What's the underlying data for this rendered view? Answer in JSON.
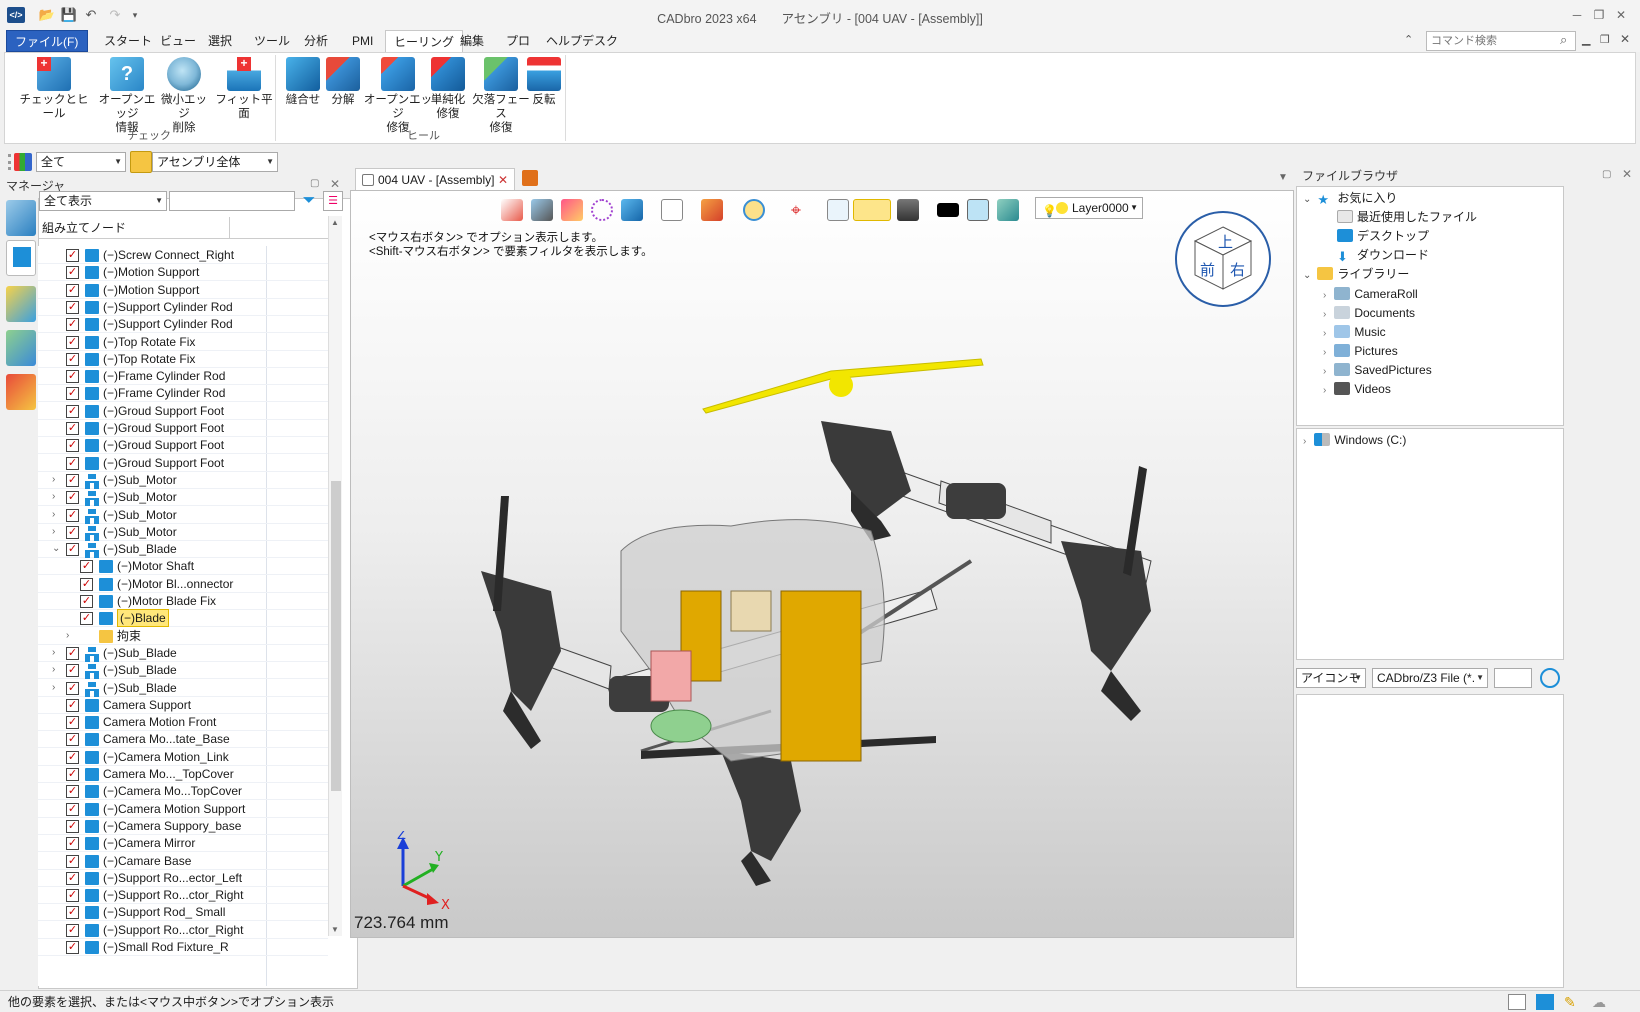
{
  "window": {
    "title": "CADbro 2023 x64　　アセンブリ - [004 UAV - [Assembly]]",
    "app_icon": "cadbro-logo-icon"
  },
  "menu": {
    "tabs": [
      "ファイル(F)",
      "スタート",
      "ビュー",
      "選択",
      "ツール",
      "分析",
      "PMI",
      "ヒーリング",
      "編集",
      "プロ",
      "ヘルプデスク"
    ],
    "active": "ヒーリング",
    "search_placeholder": "コマンド検索"
  },
  "ribbon": {
    "groups": [
      {
        "label": "チェック",
        "buttons": [
          "チェックとヒール",
          "オープンエッジ\n情報",
          "微小エッジ\n削除",
          "フィット平面"
        ]
      },
      {
        "label": "ヒール",
        "buttons": [
          "縫合せ",
          "分解",
          "オープンエッジ\n修復",
          "単純化\n修復",
          "欠落フェース\n修復",
          "反転"
        ]
      }
    ]
  },
  "filterbar": {
    "filter_value": "全て",
    "scope_value": "アセンブリ全体"
  },
  "manager": {
    "title": "マネージャ",
    "display_mode": "全て表示",
    "column_header": "組み立てノード",
    "rows": [
      {
        "label": "(−)Screw Connect_Right",
        "indent": 0,
        "type": "part",
        "exp": ""
      },
      {
        "label": "(−)Motion Support",
        "indent": 0,
        "type": "part",
        "exp": ""
      },
      {
        "label": "(−)Motion Support",
        "indent": 0,
        "type": "part",
        "exp": ""
      },
      {
        "label": "(−)Support Cylinder Rod",
        "indent": 0,
        "type": "part",
        "exp": ""
      },
      {
        "label": "(−)Support Cylinder Rod",
        "indent": 0,
        "type": "part",
        "exp": ""
      },
      {
        "label": "(−)Top Rotate Fix",
        "indent": 0,
        "type": "part",
        "exp": ""
      },
      {
        "label": "(−)Top Rotate Fix",
        "indent": 0,
        "type": "part",
        "exp": ""
      },
      {
        "label": "(−)Frame Cylinder Rod",
        "indent": 0,
        "type": "part",
        "exp": ""
      },
      {
        "label": "(−)Frame Cylinder Rod",
        "indent": 0,
        "type": "part",
        "exp": ""
      },
      {
        "label": "(−)Groud Support Foot",
        "indent": 0,
        "type": "part",
        "exp": ""
      },
      {
        "label": "(−)Groud Support Foot",
        "indent": 0,
        "type": "part",
        "exp": ""
      },
      {
        "label": "(−)Groud Support Foot",
        "indent": 0,
        "type": "part",
        "exp": ""
      },
      {
        "label": "(−)Groud Support Foot",
        "indent": 0,
        "type": "part",
        "exp": ""
      },
      {
        "label": "(−)Sub_Motor",
        "indent": 0,
        "type": "asm",
        "exp": "›"
      },
      {
        "label": "(−)Sub_Motor",
        "indent": 0,
        "type": "asm",
        "exp": "›"
      },
      {
        "label": "(−)Sub_Motor",
        "indent": 0,
        "type": "asm",
        "exp": "›"
      },
      {
        "label": "(−)Sub_Motor",
        "indent": 0,
        "type": "asm",
        "exp": "›"
      },
      {
        "label": "(−)Sub_Blade",
        "indent": 0,
        "type": "asm",
        "exp": "⌄"
      },
      {
        "label": "(−)Motor Shaft",
        "indent": 1,
        "type": "part",
        "exp": ""
      },
      {
        "label": "(−)Motor Bl...onnector",
        "indent": 1,
        "type": "part",
        "exp": ""
      },
      {
        "label": "(−)Motor Blade Fix",
        "indent": 1,
        "type": "part",
        "exp": ""
      },
      {
        "label": "(−)Blade",
        "indent": 1,
        "type": "part",
        "exp": "",
        "selected": true
      },
      {
        "label": "拘束",
        "indent": 1,
        "type": "folder",
        "exp": "›",
        "nochk": true
      },
      {
        "label": "(−)Sub_Blade",
        "indent": 0,
        "type": "asm",
        "exp": "›"
      },
      {
        "label": "(−)Sub_Blade",
        "indent": 0,
        "type": "asm",
        "exp": "›"
      },
      {
        "label": "(−)Sub_Blade",
        "indent": 0,
        "type": "asm",
        "exp": "›"
      },
      {
        "label": "Camera Support",
        "indent": 0,
        "type": "part",
        "exp": ""
      },
      {
        "label": "Camera Motion Front",
        "indent": 0,
        "type": "part",
        "exp": ""
      },
      {
        "label": "Camera Mo...tate_Base",
        "indent": 0,
        "type": "part",
        "exp": ""
      },
      {
        "label": "(−)Camera Motion_Link",
        "indent": 0,
        "type": "part",
        "exp": ""
      },
      {
        "label": "Camera Mo..._TopCover",
        "indent": 0,
        "type": "part",
        "exp": ""
      },
      {
        "label": "(−)Camera Mo...TopCover",
        "indent": 0,
        "type": "part",
        "exp": ""
      },
      {
        "label": "(−)Camera Motion Support",
        "indent": 0,
        "type": "part",
        "exp": ""
      },
      {
        "label": "(−)Camera Suppory_base",
        "indent": 0,
        "type": "part",
        "exp": ""
      },
      {
        "label": "(−)Camera Mirror",
        "indent": 0,
        "type": "part",
        "exp": ""
      },
      {
        "label": "(−)Camare Base",
        "indent": 0,
        "type": "part",
        "exp": ""
      },
      {
        "label": "(−)Support Ro...ector_Left",
        "indent": 0,
        "type": "part",
        "exp": ""
      },
      {
        "label": "(−)Support Ro...ctor_Right",
        "indent": 0,
        "type": "part",
        "exp": ""
      },
      {
        "label": "(−)Support Rod_ Small",
        "indent": 0,
        "type": "part",
        "exp": ""
      },
      {
        "label": "(−)Support Ro...ctor_Right",
        "indent": 0,
        "type": "part",
        "exp": ""
      },
      {
        "label": "(−)Small Rod Fixture_R",
        "indent": 0,
        "type": "part",
        "exp": ""
      }
    ]
  },
  "viewport": {
    "doc_tab": "004 UAV - [Assembly]",
    "layer": "Layer0000",
    "hint1": "<マウス右ボタン> でオプション表示します。",
    "hint2": "<Shift-マウス右ボタン> で要素フィルタを表示します。",
    "scale": "723.764 mm",
    "viewcube": {
      "top": "上",
      "front": "前",
      "right": "右"
    },
    "axes": {
      "x": "X",
      "y": "Y",
      "z": "Z"
    },
    "colors": {
      "blade_selected": "#f2e600",
      "body": "#3a3a3a",
      "tube": "#eeeeee",
      "frame": "#e0a800"
    }
  },
  "filebrowser": {
    "title": "ファイルブラウザ",
    "favorites": "お気に入り",
    "fav_items": [
      "最近使用したファイル",
      "デスクトップ",
      "ダウンロード"
    ],
    "library": "ライブラリー",
    "lib_items": [
      "CameraRoll",
      "Documents",
      "Music",
      "Pictures",
      "SavedPictures",
      "Videos"
    ],
    "drive": "Windows  (C:)",
    "view_mode": "アイコンモード",
    "file_filter": "CADbro/Z3 File (*."
  },
  "status": {
    "text": "他の要素を選択、または<マウス中ボタン>でオプション表示"
  }
}
